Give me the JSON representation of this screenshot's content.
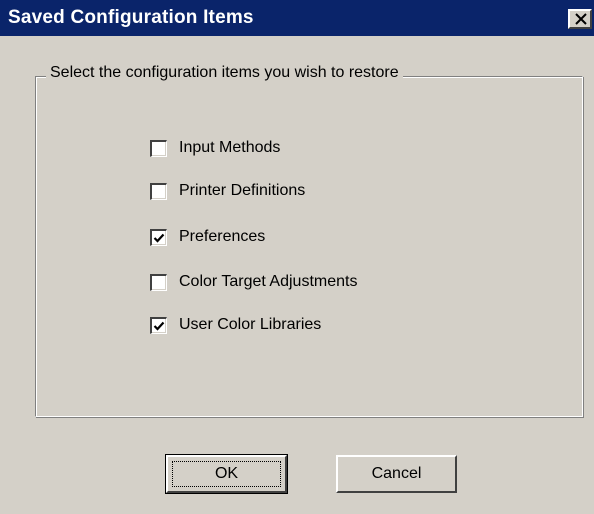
{
  "window": {
    "title": "Saved Configuration Items",
    "close_icon": "close-icon"
  },
  "group": {
    "legend": "Select the configuration items you wish to restore"
  },
  "items": [
    {
      "label": "Input Methods",
      "checked": false
    },
    {
      "label": "Printer Definitions",
      "checked": false
    },
    {
      "label": "Preferences",
      "checked": true
    },
    {
      "label": "Color Target Adjustments",
      "checked": false
    },
    {
      "label": "User Color Libraries",
      "checked": true
    }
  ],
  "buttons": {
    "ok_label": "OK",
    "cancel_label": "Cancel"
  },
  "colors": {
    "titlebar": "#0a246a",
    "face": "#d4d0c8"
  }
}
